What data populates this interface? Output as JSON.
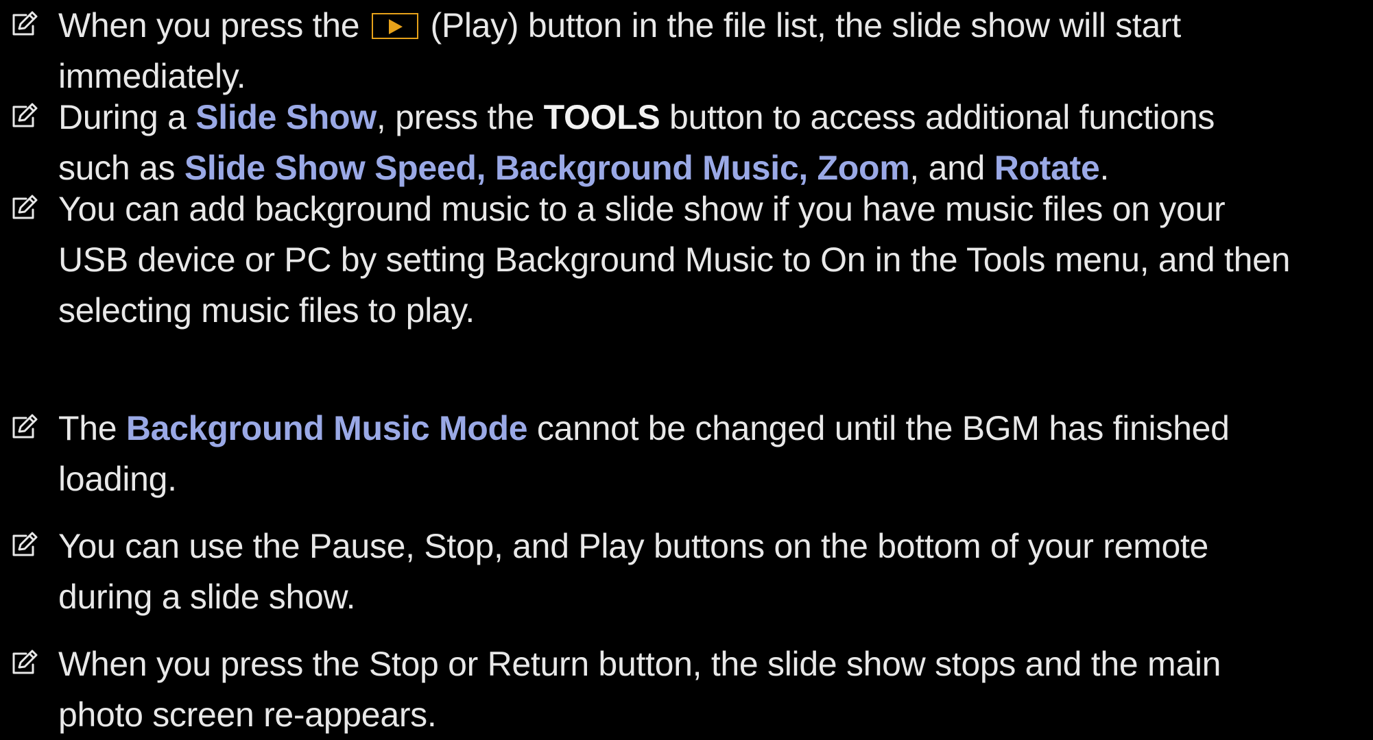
{
  "icon": "note-pencil-icon",
  "accent_color": "#9aa9e6",
  "play_key_color": "#e7a21a",
  "notes": [
    {
      "l1_a": "When you press the",
      "play_key_icon": "play-triangle-icon",
      "l1_b": "(Play) button in the file list, the slide show will start",
      "l2": "immediately."
    },
    {
      "l1_a": "During a ",
      "l1_hl": "Slide Show",
      "l1_b": ", press the ",
      "l1_bold": "TOOLS",
      "l1_c": " button to access additional functions",
      "l2_a": "such as ",
      "l2_hl": "Slide Show Speed, Background Music, Zoom",
      "l2_b": ", and ",
      "l2_hl2": "Rotate",
      "l2_c": "."
    },
    {
      "l1": "You can add background music to a slide show if you have music files on your",
      "l2": "USB device or PC by setting Background Music to On in the Tools menu, and then",
      "l3": "selecting music files to play."
    },
    {
      "l1_a": "The ",
      "l1_hl": "Background Music Mode",
      "l1_b": " cannot be changed until the BGM has finished",
      "l2": "loading."
    },
    {
      "l1": "You can use the Pause, Stop, and Play buttons on the bottom of your remote",
      "l2": "during a slide show."
    },
    {
      "l1": "When you press the Stop or Return button, the slide show stops and the main",
      "l2": "photo screen re-appears."
    }
  ]
}
